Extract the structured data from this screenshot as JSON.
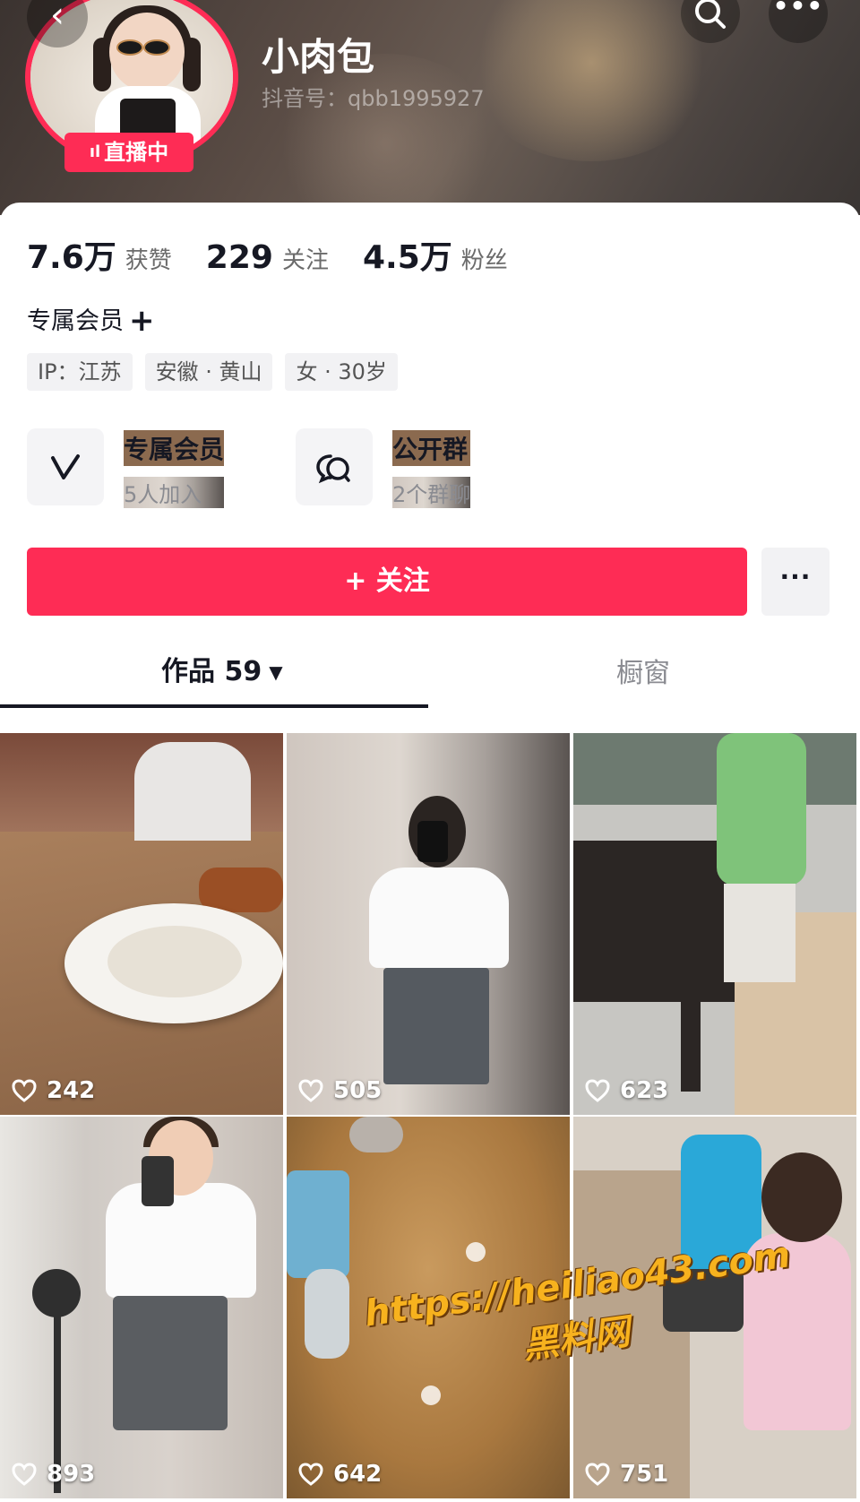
{
  "profile": {
    "nickname": "小肉包",
    "douyin_id": "抖音号：qbb1995927",
    "live_badge": "直播中"
  },
  "stats": [
    {
      "value": "7.6万",
      "label": "获赞"
    },
    {
      "value": "229",
      "label": "关注"
    },
    {
      "value": "4.5万",
      "label": "粉丝"
    }
  ],
  "membership_line": "专属会员",
  "tags": [
    "IP：江苏",
    "安徽 · 黄山",
    "女 · 30岁"
  ],
  "features": [
    {
      "title": "专属会员",
      "subtitle": "5人加入",
      "icon": "v-member-icon"
    },
    {
      "title": "公开群",
      "subtitle": "2个群聊",
      "icon": "chat-group-icon"
    }
  ],
  "follow_button": "+ 关注",
  "more_label": "···",
  "tabs": {
    "works": "作品 59",
    "shop": "橱窗"
  },
  "videos": [
    {
      "likes": "242"
    },
    {
      "likes": "505"
    },
    {
      "likes": "623"
    },
    {
      "likes": "893"
    },
    {
      "likes": "642"
    },
    {
      "likes": "751"
    }
  ],
  "watermark": {
    "line1": "https://heiliao43.com",
    "line2": "黑料网"
  },
  "colors": {
    "accent": "#fe2c55",
    "watermark": "#f7b21e"
  }
}
